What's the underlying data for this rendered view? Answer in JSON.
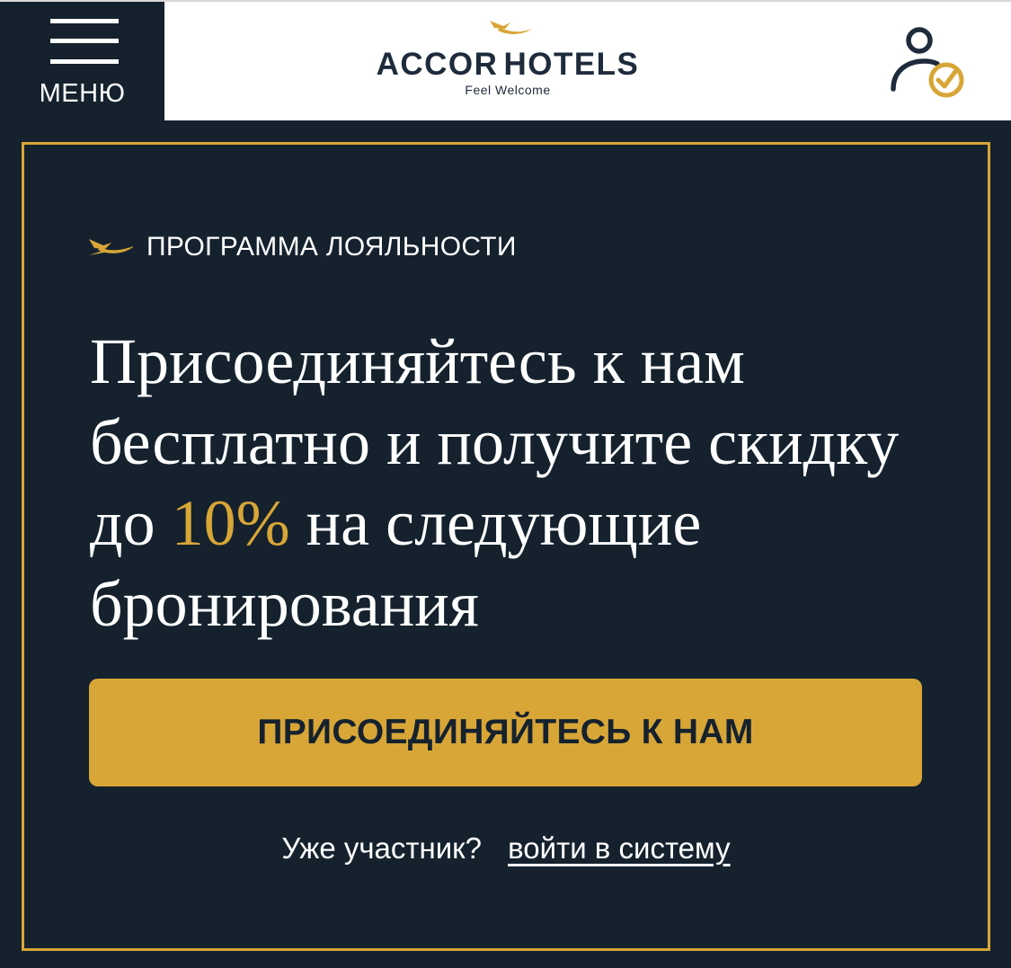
{
  "header": {
    "menu_label": "МЕНЮ",
    "menu_icon": "hamburger-icon",
    "logo": {
      "brand": "ACCORHOTELS",
      "brand_part1": "ACCOR",
      "brand_part2": "HOTELS",
      "tagline": "Feel Welcome"
    },
    "account_icon": "user-check-icon"
  },
  "promo": {
    "eyebrow_icon": "bird-icon",
    "eyebrow": "ПРОГРАММА ЛОЯЛЬНОСТИ",
    "headline_before": "Присоединяйтесь к нам бесплатно и получите скидку до ",
    "headline_highlight": "10%",
    "headline_after": " на следующие бронирования",
    "join_button_label": "ПРИСОЕДИНЯЙТЕСЬ К НАМ",
    "member_question": "Уже участник?",
    "login_link_label": "войти в систему"
  },
  "colors": {
    "navy": "#15222e",
    "gold": "#d8a637",
    "white": "#ffffff"
  }
}
